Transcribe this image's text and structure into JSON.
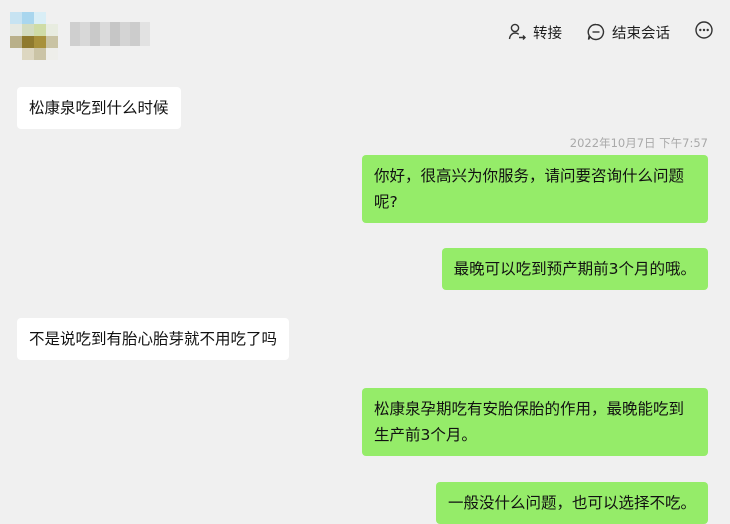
{
  "header": {
    "contact_name": "",
    "transfer_label": "转接",
    "end_session_label": "结束会话"
  },
  "colors": {
    "background": "#f0f0f0",
    "incoming_bubble": "#ffffff",
    "outgoing_bubble": "#95ec69",
    "timestamp_text": "#a9a9a9"
  },
  "messages": [
    {
      "direction": "incoming",
      "text": "松康泉吃到什么时候"
    },
    {
      "direction": "outgoing",
      "text": "你好，很高兴为你服务，请问要咨询什么问题呢?"
    },
    {
      "direction": "outgoing",
      "text": "最晚可以吃到预产期前3个月的哦。"
    },
    {
      "direction": "incoming",
      "text": "不是说吃到有胎心胎芽就不用吃了吗"
    },
    {
      "direction": "outgoing",
      "text": "松康泉孕期吃有安胎保胎的作用，最晚能吃到生产前3个月。"
    },
    {
      "direction": "outgoing",
      "text": "一般没什么问题，也可以选择不吃。"
    }
  ],
  "timestamp": "2022年10月7日 下午7:57",
  "icons": [
    "transfer-icon",
    "end-session-icon",
    "more-icon"
  ]
}
